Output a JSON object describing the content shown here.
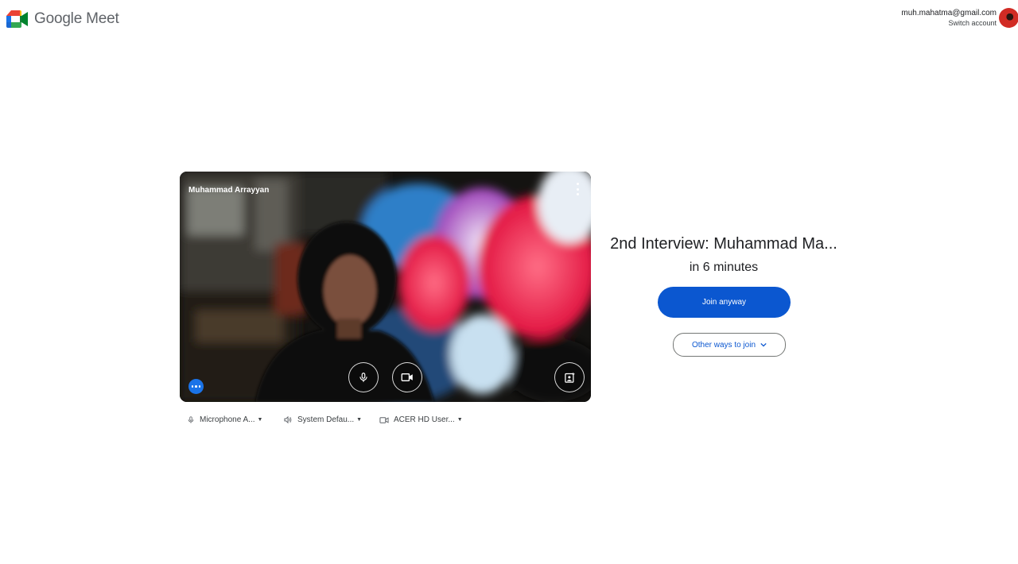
{
  "header": {
    "app_name": "Google Meet",
    "account_email": "muh.mahatma@gmail.com",
    "switch_account_label": "Switch account"
  },
  "preview": {
    "participant_name": "Muhammad Arrayyan",
    "controls": {
      "mic_icon": "mic-icon",
      "camera_icon": "videocam-icon",
      "effects_icon": "visual-effects-icon",
      "more_options_icon": "more-horiz-icon",
      "menu_icon": "more-vert-icon"
    }
  },
  "devices": {
    "microphone": "Microphone A...",
    "speaker": "System Defau...",
    "camera": "ACER HD User..."
  },
  "meeting": {
    "title": "2nd Interview: Muhammad Ma...",
    "starts_in": "in 6 minutes",
    "join_label": "Join anyway",
    "other_ways_label": "Other ways to join"
  },
  "colors": {
    "join_button": "#0b57d0",
    "link_text": "#0b57d0",
    "more_button": "#1a73e8"
  }
}
